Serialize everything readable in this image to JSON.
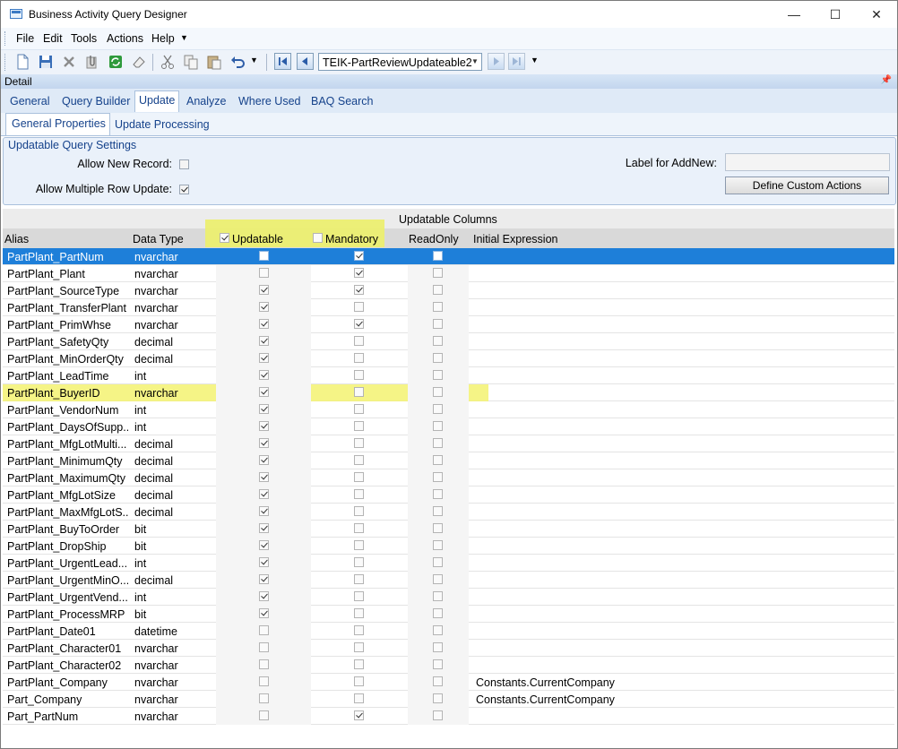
{
  "window": {
    "title": "Business Activity Query Designer",
    "minimize": "—",
    "maximize": "☐",
    "close": "✕"
  },
  "menu": [
    "File",
    "Edit",
    "Tools",
    "Actions",
    "Help"
  ],
  "toolbar": {
    "record_combo_value": "TEIK-PartReviewUpdateable2"
  },
  "detail_label": "Detail",
  "tabs": [
    "General",
    "Query Builder",
    "Update",
    "Analyze",
    "Where Used",
    "BAQ Search"
  ],
  "active_tab": "Update",
  "subtabs": [
    "General Properties",
    "Update  Processing"
  ],
  "active_subtab": "General Properties",
  "settings": {
    "group_title": "Updatable Query Settings",
    "allow_new_record_label": "Allow New Record:",
    "allow_new_record": false,
    "allow_multiple_label": "Allow Multiple Row Update:",
    "allow_multiple": true,
    "label_for_addnew_label": "Label for AddNew:",
    "label_for_addnew_value": "",
    "define_actions_button": "Define Custom Actions"
  },
  "grid": {
    "group_header": "Updatable Columns",
    "columns": {
      "alias": "Alias",
      "data_type": "Data Type",
      "updatable": "Updatable",
      "mandatory": "Mandatory",
      "readonly": "ReadOnly",
      "initial_expression": "Initial Expression"
    },
    "header_updatable_checked": true,
    "header_mandatory_checked": false,
    "highlight_color": "#f3f271",
    "selected_color": "#1e7fd9",
    "rows": [
      {
        "alias": "PartPlant_PartNum",
        "type": "nvarchar",
        "updatable": false,
        "mandatory": true,
        "readonly": false,
        "init": "",
        "selected": true
      },
      {
        "alias": "PartPlant_Plant",
        "type": "nvarchar",
        "updatable": false,
        "mandatory": true,
        "readonly": false,
        "init": ""
      },
      {
        "alias": "PartPlant_SourceType",
        "type": "nvarchar",
        "updatable": true,
        "mandatory": true,
        "readonly": false,
        "init": ""
      },
      {
        "alias": "PartPlant_TransferPlant",
        "type": "nvarchar",
        "updatable": true,
        "mandatory": false,
        "readonly": false,
        "init": ""
      },
      {
        "alias": "PartPlant_PrimWhse",
        "type": "nvarchar",
        "updatable": true,
        "mandatory": true,
        "readonly": false,
        "init": ""
      },
      {
        "alias": "PartPlant_SafetyQty",
        "type": "decimal",
        "updatable": true,
        "mandatory": false,
        "readonly": false,
        "init": ""
      },
      {
        "alias": "PartPlant_MinOrderQty",
        "type": "decimal",
        "updatable": true,
        "mandatory": false,
        "readonly": false,
        "init": ""
      },
      {
        "alias": "PartPlant_LeadTime",
        "type": "int",
        "updatable": true,
        "mandatory": false,
        "readonly": false,
        "init": ""
      },
      {
        "alias": "PartPlant_BuyerID",
        "type": "nvarchar",
        "updatable": true,
        "mandatory": false,
        "readonly": false,
        "init": "",
        "highlighted": true
      },
      {
        "alias": "PartPlant_VendorNum",
        "type": "int",
        "updatable": true,
        "mandatory": false,
        "readonly": false,
        "init": ""
      },
      {
        "alias": "PartPlant_DaysOfSupp...",
        "type": "int",
        "updatable": true,
        "mandatory": false,
        "readonly": false,
        "init": ""
      },
      {
        "alias": "PartPlant_MfgLotMulti...",
        "type": "decimal",
        "updatable": true,
        "mandatory": false,
        "readonly": false,
        "init": ""
      },
      {
        "alias": "PartPlant_MinimumQty",
        "type": "decimal",
        "updatable": true,
        "mandatory": false,
        "readonly": false,
        "init": ""
      },
      {
        "alias": "PartPlant_MaximumQty",
        "type": "decimal",
        "updatable": true,
        "mandatory": false,
        "readonly": false,
        "init": ""
      },
      {
        "alias": "PartPlant_MfgLotSize",
        "type": "decimal",
        "updatable": true,
        "mandatory": false,
        "readonly": false,
        "init": ""
      },
      {
        "alias": "PartPlant_MaxMfgLotS...",
        "type": "decimal",
        "updatable": true,
        "mandatory": false,
        "readonly": false,
        "init": ""
      },
      {
        "alias": "PartPlant_BuyToOrder",
        "type": "bit",
        "updatable": true,
        "mandatory": false,
        "readonly": false,
        "init": ""
      },
      {
        "alias": "PartPlant_DropShip",
        "type": "bit",
        "updatable": true,
        "mandatory": false,
        "readonly": false,
        "init": ""
      },
      {
        "alias": "PartPlant_UrgentLead...",
        "type": "int",
        "updatable": true,
        "mandatory": false,
        "readonly": false,
        "init": ""
      },
      {
        "alias": "PartPlant_UrgentMinO...",
        "type": "decimal",
        "updatable": true,
        "mandatory": false,
        "readonly": false,
        "init": ""
      },
      {
        "alias": "PartPlant_UrgentVend...",
        "type": "int",
        "updatable": true,
        "mandatory": false,
        "readonly": false,
        "init": ""
      },
      {
        "alias": "PartPlant_ProcessMRP",
        "type": "bit",
        "updatable": true,
        "mandatory": false,
        "readonly": false,
        "init": ""
      },
      {
        "alias": "PartPlant_Date01",
        "type": "datetime",
        "updatable": false,
        "mandatory": false,
        "readonly": false,
        "init": ""
      },
      {
        "alias": "PartPlant_Character01",
        "type": "nvarchar",
        "updatable": false,
        "mandatory": false,
        "readonly": false,
        "init": ""
      },
      {
        "alias": "PartPlant_Character02",
        "type": "nvarchar",
        "updatable": false,
        "mandatory": false,
        "readonly": false,
        "init": ""
      },
      {
        "alias": "PartPlant_Company",
        "type": "nvarchar",
        "updatable": false,
        "mandatory": false,
        "readonly": false,
        "init": "Constants.CurrentCompany"
      },
      {
        "alias": "Part_Company",
        "type": "nvarchar",
        "updatable": false,
        "mandatory": false,
        "readonly": false,
        "init": "Constants.CurrentCompany"
      },
      {
        "alias": "Part_PartNum",
        "type": "nvarchar",
        "updatable": false,
        "mandatory": true,
        "readonly": false,
        "init": ""
      }
    ]
  }
}
